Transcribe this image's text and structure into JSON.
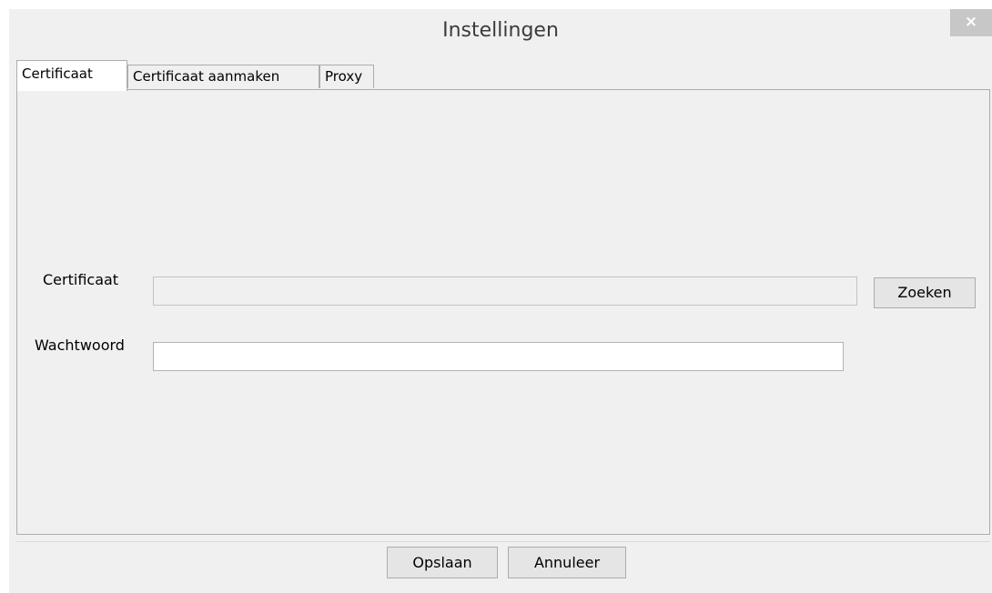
{
  "window": {
    "title": "Instellingen",
    "close_label": "×"
  },
  "tabs": [
    {
      "label": "Certificaat",
      "active": true
    },
    {
      "label": "Certificaat aanmaken",
      "active": false
    },
    {
      "label": "Proxy",
      "active": false
    }
  ],
  "certificate_tab": {
    "certificate_label": "Certificaat",
    "certificate_value": "",
    "search_button_label": "Zoeken",
    "password_label": "Wachtwoord",
    "password_value": ""
  },
  "footer": {
    "save_label": "Opslaan",
    "cancel_label": "Annuleer"
  }
}
